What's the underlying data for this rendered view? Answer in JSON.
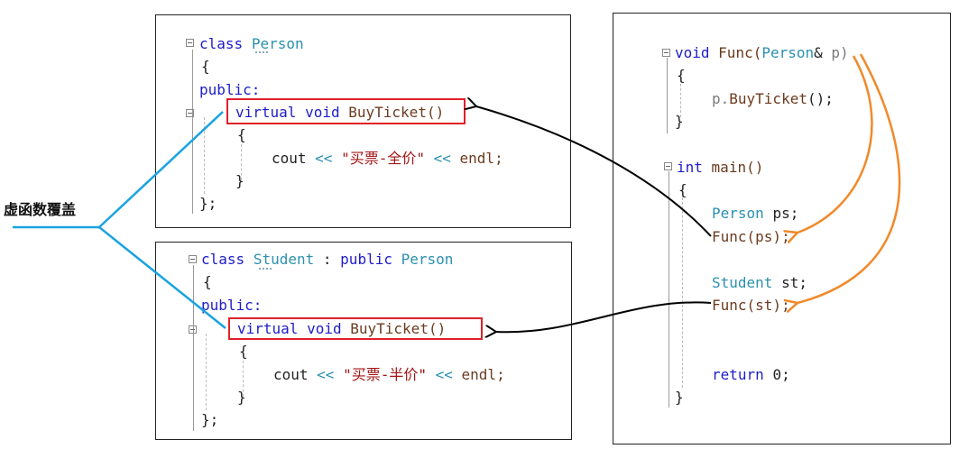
{
  "label": "虚函数覆盖",
  "person": {
    "l1": [
      "class",
      "Person"
    ],
    "l2": "{",
    "l3": "public:",
    "l4": [
      "virtual",
      "void",
      "BuyTicket()"
    ],
    "l5": "{",
    "l6": [
      "cout",
      "<<",
      "\"买票-全价\"",
      "<<",
      "endl;"
    ],
    "l7": "}",
    "l8": "};"
  },
  "student": {
    "l1": [
      "class",
      "Student",
      ":",
      "public",
      "Person"
    ],
    "l2": "{",
    "l3": "public:",
    "l4": [
      "virtual",
      "void",
      "BuyTicket()"
    ],
    "l5": "{",
    "l6": [
      "cout",
      "<<",
      "\"买票-半价\"",
      "<<",
      "endl;"
    ],
    "l7": "}",
    "l8": "};"
  },
  "main": {
    "f1": [
      "void",
      "Func(",
      "Person",
      "&",
      "p)"
    ],
    "f2": "{",
    "f3": [
      "p.",
      "BuyTicket",
      "();"
    ],
    "f4": "}",
    "m1": [
      "int",
      "main()"
    ],
    "m2": "{",
    "m3": [
      "Person",
      "ps;"
    ],
    "m4": "Func(ps);",
    "m5": [
      "Student",
      "st;"
    ],
    "m6": "Func(st);",
    "m7": [
      "return",
      "0;"
    ],
    "m8": "}"
  },
  "colors": {
    "keyword": "#1d1dc9",
    "type": "#2b91af",
    "string": "#a31515",
    "highlight_box": "#e0202a",
    "label_line": "#1aa3e0",
    "call_arrow": "#000000",
    "param_arrow": "#f08a2a"
  }
}
